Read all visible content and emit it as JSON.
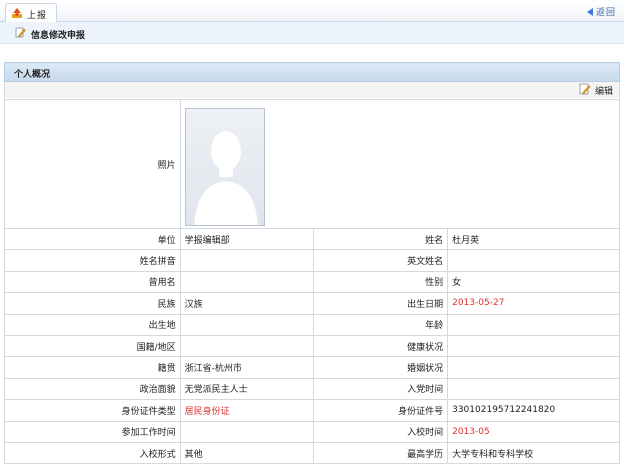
{
  "tabbar": {
    "tab_label": "上报",
    "back_label": "返回"
  },
  "title": "信息修改申报",
  "section": "个人概况",
  "toolbar": {
    "edit_label": "编辑"
  },
  "photo_label": "照片",
  "rows": [
    {
      "l1": "单位",
      "v1": "学报编辑部",
      "l2": "姓名",
      "v2": "杜月英"
    },
    {
      "l1": "姓名拼音",
      "v1": "",
      "l2": "英文姓名",
      "v2": ""
    },
    {
      "l1": "曾用名",
      "v1": "",
      "l2": "性别",
      "v2": "女"
    },
    {
      "l1": "民族",
      "v1": "汉族",
      "l2": "出生日期",
      "v2": "2013-05-27"
    },
    {
      "l1": "出生地",
      "v1": "",
      "l2": "年龄",
      "v2": ""
    },
    {
      "l1": "国籍/地区",
      "v1": "",
      "l2": "健康状况",
      "v2": ""
    },
    {
      "l1": "籍贯",
      "v1": "浙江省-杭州市",
      "l2": "婚姻状况",
      "v2": ""
    },
    {
      "l1": "政治面貌",
      "v1": "无党派民主人士",
      "l2": "入党时间",
      "v2": ""
    },
    {
      "l1": "身份证件类型",
      "v1": "居民身份证",
      "l2": "身份证件号",
      "v2": "330102195712241820"
    },
    {
      "l1": "参加工作时间",
      "v1": "",
      "l2": "入校时间",
      "v2": "2013-05"
    },
    {
      "l1": "入校形式",
      "v1": "其他",
      "l2": "最高学历",
      "v2": "大学专科和专科学校"
    }
  ],
  "colors": {
    "highlight": "#e03030",
    "accent": "#3366aa"
  }
}
